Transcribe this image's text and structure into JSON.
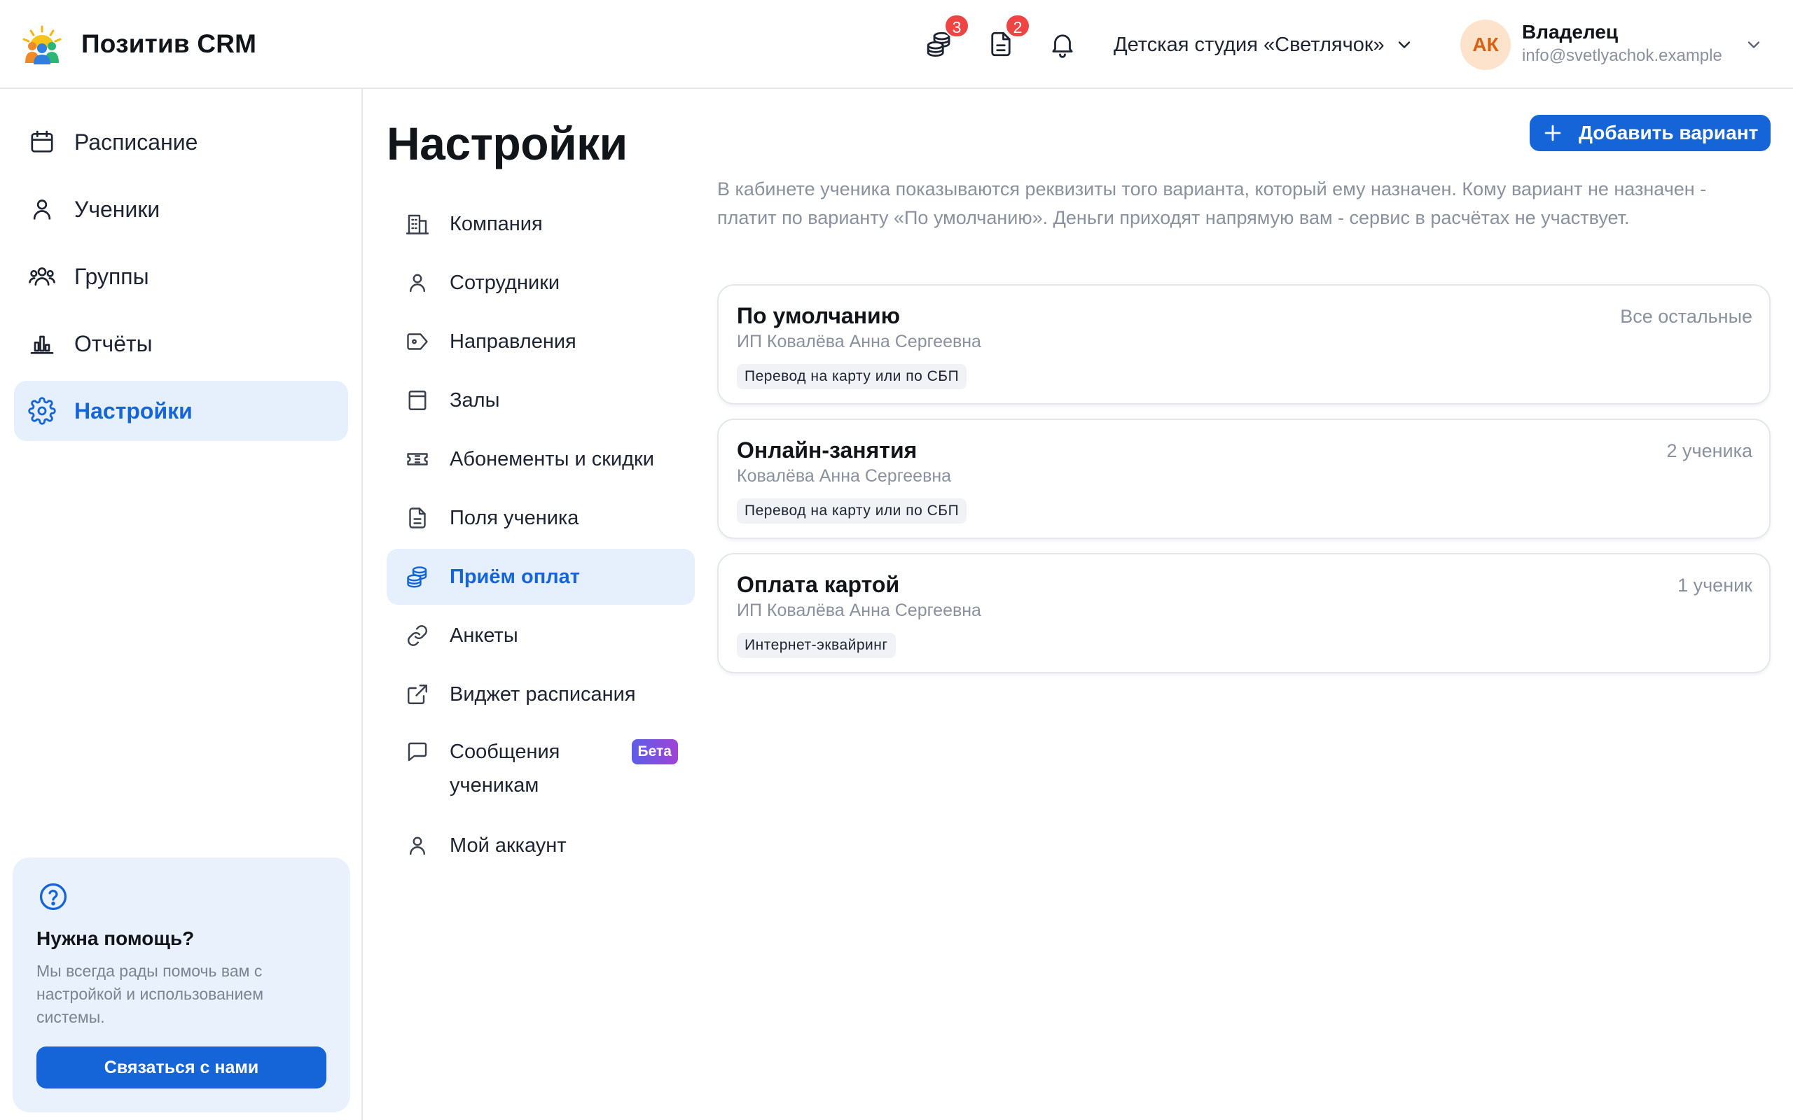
{
  "app": {
    "name": "Позитив CRM"
  },
  "header": {
    "payments_badge": "3",
    "documents_badge": "2",
    "studio_name": "Детская студия «Светлячок»",
    "user": {
      "initials": "АК",
      "role": "Владелец",
      "email": "info@svetlyachok.example"
    }
  },
  "sidebar": {
    "items": [
      {
        "label": "Расписание",
        "icon": "calendar-icon"
      },
      {
        "label": "Ученики",
        "icon": "user-icon"
      },
      {
        "label": "Группы",
        "icon": "users-icon"
      },
      {
        "label": "Отчёты",
        "icon": "chart-icon"
      },
      {
        "label": "Настройки",
        "icon": "gear-icon",
        "active": true
      }
    ],
    "help": {
      "title": "Нужна помощь?",
      "text": "Мы всегда рады помочь вам с настройкой и использованием системы.",
      "button": "Связаться с нами"
    }
  },
  "settings": {
    "title": "Настройки",
    "menu": [
      {
        "label": "Компания",
        "icon": "building-icon"
      },
      {
        "label": "Сотрудники",
        "icon": "user-icon"
      },
      {
        "label": "Направления",
        "icon": "tag-icon"
      },
      {
        "label": "Залы",
        "icon": "room-icon"
      },
      {
        "label": "Абонементы и скидки",
        "icon": "ticket-icon"
      },
      {
        "label": "Поля ученика",
        "icon": "document-icon"
      },
      {
        "label": "Приём оплат",
        "icon": "coins-icon",
        "active": true
      },
      {
        "label": "Анкеты",
        "icon": "link-icon"
      },
      {
        "label": "Виджет расписания",
        "icon": "external-link-icon"
      },
      {
        "label": "Сообщения ученикам",
        "icon": "message-icon",
        "badge": "Бета"
      },
      {
        "label": "Мой аккаунт",
        "icon": "user-icon"
      }
    ]
  },
  "payments": {
    "add_button": "Добавить вариант",
    "intro": "В кабинете ученика показываются реквизиты того варианта, который ему назначен. Кому вариант не назначен - платит по варианту «По умолчанию». Деньги приходят напрямую вам - сервис в расчётах не участвует.",
    "variants": [
      {
        "name": "По умолчанию",
        "owner": "ИП Ковалёва Анна Сергеевна",
        "method": "Перевод на карту или по СБП",
        "assigned": "Все остальные"
      },
      {
        "name": "Онлайн-занятия",
        "owner": "Ковалёва Анна Сергеевна",
        "method": "Перевод на карту или по СБП",
        "assigned": "2 ученика"
      },
      {
        "name": "Оплата картой",
        "owner": "ИП Ковалёва Анна Сергеевна",
        "method": "Интернет-эквайринг",
        "assigned": "1 ученик"
      }
    ]
  },
  "colors": {
    "accent": "#1565d8",
    "accent_bg": "#e6f0fd",
    "badge_red": "#ef4444"
  }
}
